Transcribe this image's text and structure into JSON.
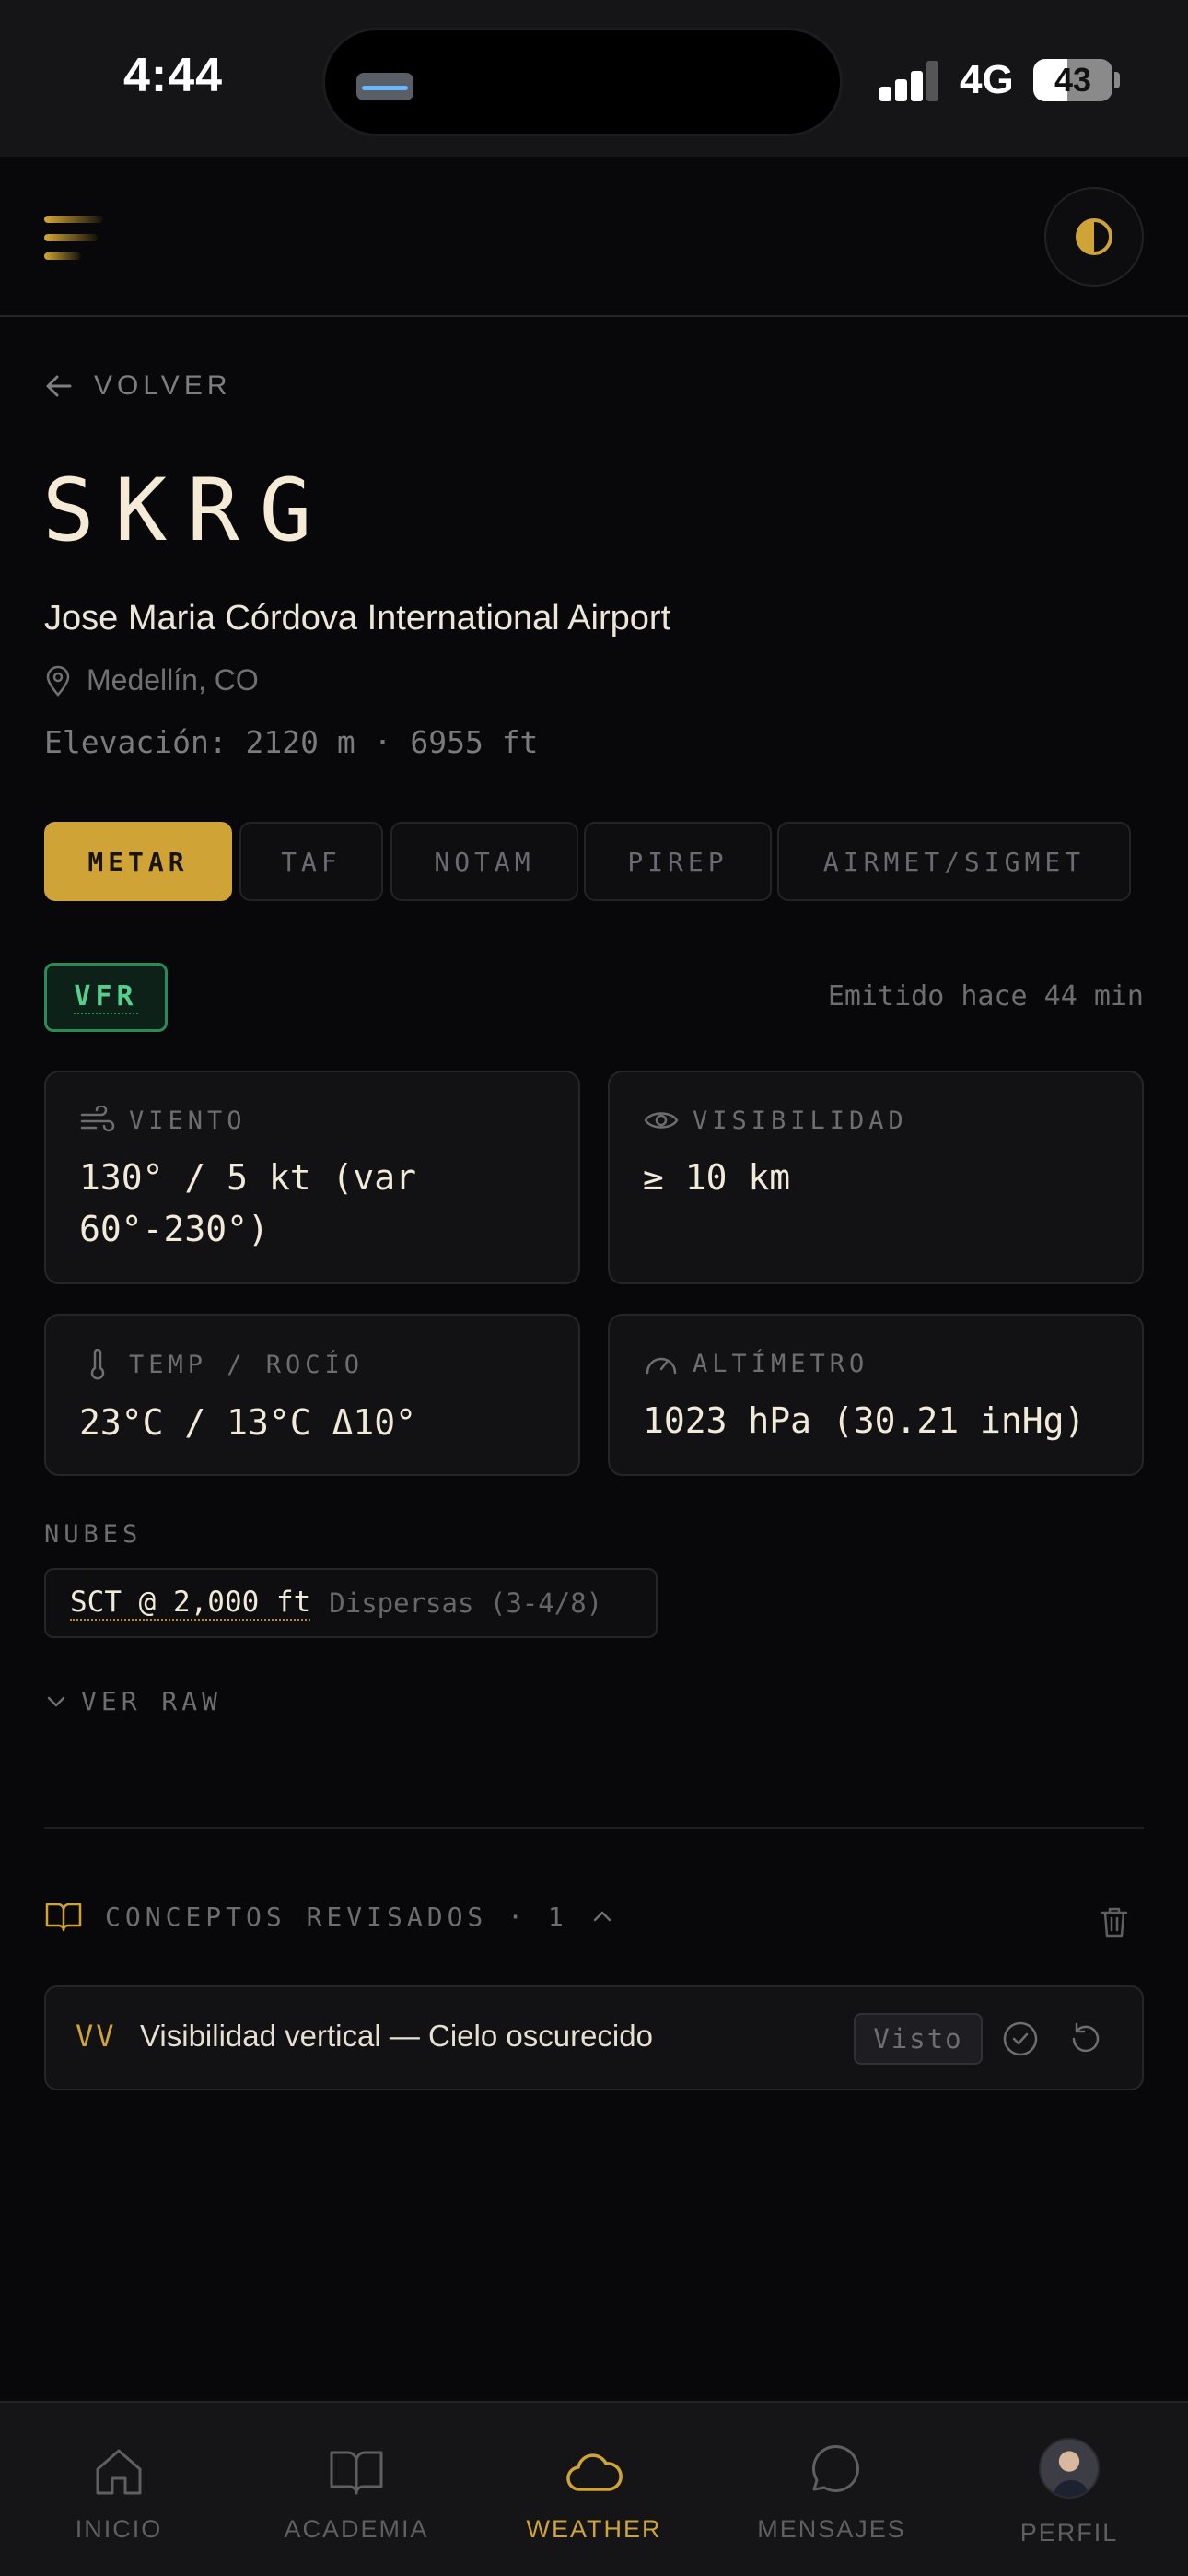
{
  "status_bar": {
    "time": "4:44",
    "network": "4G",
    "battery": "43",
    "battery_level": 0.43
  },
  "header": {
    "menu_icon": "menu-icon",
    "theme_icon": "half-circle-icon"
  },
  "nav_back": {
    "label": "VOLVER"
  },
  "station": {
    "code": "SKRG",
    "name": "Jose Maria Córdova International Airport",
    "location": "Medellín, CO",
    "elevation": "Elevación: 2120 m · 6955 ft"
  },
  "tabs": [
    {
      "label": "METAR",
      "active": true
    },
    {
      "label": "TAF",
      "active": false
    },
    {
      "label": "NOTAM",
      "active": false
    },
    {
      "label": "PIREP",
      "active": false
    },
    {
      "label": "AIRMET/SIGMET",
      "active": false
    }
  ],
  "metar": {
    "flight_category": "VFR",
    "issued": "Emitido hace 44 min",
    "wind": {
      "label": "VIENTO",
      "value": "130° / 5 kt (var 60°-230°)"
    },
    "visibility": {
      "label": "VISIBILIDAD",
      "value": "≥ 10 km"
    },
    "temp": {
      "label": "TEMP / ROCÍO",
      "value": "23°C / 13°C Δ10°"
    },
    "altimeter": {
      "label": "ALTÍMETRO",
      "value": "1023 hPa (30.21 inHg)"
    },
    "clouds_title": "NUBES",
    "cloud_layer": {
      "main": "SCT @ 2,000 ft",
      "desc": "Dispersas (3-4/8)"
    },
    "raw_toggle": "VER RAW"
  },
  "concepts": {
    "title": "CONCEPTOS REVISADOS · 1",
    "items": [
      {
        "code": "VV",
        "text": "Visibilidad vertical — Cielo oscurecido",
        "badge": "Visto"
      }
    ]
  },
  "bottom_nav": [
    {
      "label": "INICIO",
      "icon": "home-icon",
      "active": false
    },
    {
      "label": "ACADEMIA",
      "icon": "book-icon",
      "active": false
    },
    {
      "label": "WEATHER",
      "icon": "cloud-icon",
      "active": true
    },
    {
      "label": "MENSAJES",
      "icon": "message-icon",
      "active": false
    },
    {
      "label": "PERFIL",
      "icon": "avatar",
      "active": false
    }
  ],
  "colors": {
    "accent": "#cfa336",
    "vfr": "#55d08c",
    "background": "#08080a"
  }
}
